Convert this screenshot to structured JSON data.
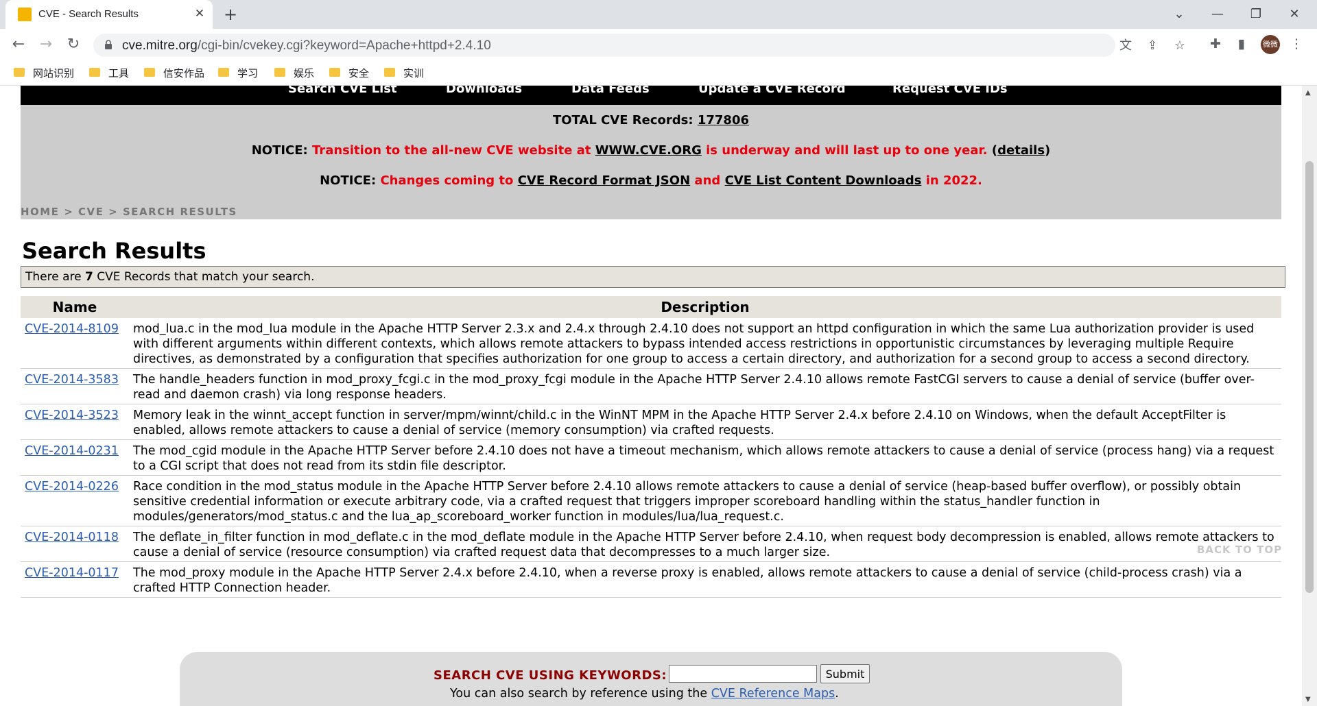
{
  "browser": {
    "tab_title": "CVE - Search Results",
    "tab_close": "✕",
    "new_tab": "+",
    "window_controls": {
      "minimize": "—",
      "restore": "❐",
      "close": "✕",
      "tab_list": "⌄"
    },
    "url_host": "cve.mitre.org",
    "url_path": "/cgi-bin/cvekey.cgi?keyword=Apache+httpd+2.4.10",
    "avatar_text": "微微",
    "bookmarks": [
      "网站识别",
      "工具",
      "信安作品",
      "学习",
      "娱乐",
      "安全",
      "实训"
    ]
  },
  "nav": {
    "items": [
      "Search CVE List",
      "Downloads",
      "Data Feeds",
      "Update a CVE Record",
      "Request CVE IDs"
    ]
  },
  "notice": {
    "total_label": "TOTAL CVE Records:",
    "total_value": "177806",
    "n1_prefix": "NOTICE:",
    "n1_red1": "Transition to the all-new CVE website at",
    "n1_link": "WWW.CVE.ORG",
    "n1_red2": "is underway and will last up to one year.",
    "n1_details_open": "(",
    "n1_details": "details",
    "n1_details_close": ")",
    "n2_prefix": "NOTICE:",
    "n2_red1": "Changes coming to",
    "n2_link1": "CVE Record Format JSON",
    "n2_and": "and",
    "n2_link2": "CVE List Content Downloads",
    "n2_red2": "in 2022."
  },
  "breadcrumb": {
    "home": "HOME",
    "sep1": ">",
    "cve": "CVE",
    "sep2": ">",
    "current": "SEARCH RESULTS"
  },
  "results": {
    "title": "Search Results",
    "match_prefix": "There are",
    "match_count": "7",
    "match_suffix": "CVE Records that match your search.",
    "col_name": "Name",
    "col_desc": "Description",
    "rows": [
      {
        "id": "CVE-2014-8109",
        "desc": "mod_lua.c in the mod_lua module in the Apache HTTP Server 2.3.x and 2.4.x through 2.4.10 does not support an httpd configuration in which the same Lua authorization provider is used with different arguments within different contexts, which allows remote attackers to bypass intended access restrictions in opportunistic circumstances by leveraging multiple Require directives, as demonstrated by a configuration that specifies authorization for one group to access a certain directory, and authorization for a second group to access a second directory."
      },
      {
        "id": "CVE-2014-3583",
        "desc": "The handle_headers function in mod_proxy_fcgi.c in the mod_proxy_fcgi module in the Apache HTTP Server 2.4.10 allows remote FastCGI servers to cause a denial of service (buffer over-read and daemon crash) via long response headers."
      },
      {
        "id": "CVE-2014-3523",
        "desc": "Memory leak in the winnt_accept function in server/mpm/winnt/child.c in the WinNT MPM in the Apache HTTP Server 2.4.x before 2.4.10 on Windows, when the default AcceptFilter is enabled, allows remote attackers to cause a denial of service (memory consumption) via crafted requests."
      },
      {
        "id": "CVE-2014-0231",
        "desc": "The mod_cgid module in the Apache HTTP Server before 2.4.10 does not have a timeout mechanism, which allows remote attackers to cause a denial of service (process hang) via a request to a CGI script that does not read from its stdin file descriptor."
      },
      {
        "id": "CVE-2014-0226",
        "desc": "Race condition in the mod_status module in the Apache HTTP Server before 2.4.10 allows remote attackers to cause a denial of service (heap-based buffer overflow), or possibly obtain sensitive credential information or execute arbitrary code, via a crafted request that triggers improper scoreboard handling within the status_handler function in modules/generators/mod_status.c and the lua_ap_scoreboard_worker function in modules/lua/lua_request.c."
      },
      {
        "id": "CVE-2014-0118",
        "desc": "The deflate_in_filter function in mod_deflate.c in the mod_deflate module in the Apache HTTP Server before 2.4.10, when request body decompression is enabled, allows remote attackers to cause a denial of service (resource consumption) via crafted request data that decompresses to a much larger size."
      },
      {
        "id": "CVE-2014-0117",
        "desc": "The mod_proxy module in the Apache HTTP Server 2.4.x before 2.4.10, when a reverse proxy is enabled, allows remote attackers to cause a denial of service (child-process crash) via a crafted HTTP Connection header."
      }
    ]
  },
  "back_to_top": "BACK TO TOP",
  "search": {
    "label": "SEARCH CVE USING KEYWORDS:",
    "input_value": "",
    "submit": "Submit",
    "also_prefix": "You can also search by reference using the",
    "also_link": "CVE Reference Maps",
    "also_suffix": "."
  }
}
